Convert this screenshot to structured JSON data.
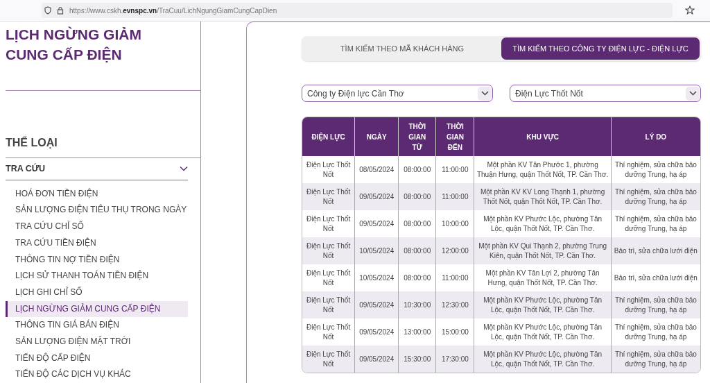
{
  "browser": {
    "url": "https://www.cskh.**evnspc.vn**/TraCuu/LichNgungGiamCungCapDien"
  },
  "page_title": "LỊCH NGỪNG GIẢM CUNG CẤP ĐIỆN",
  "sidebar": {
    "heading": "THỂ LOẠI",
    "section": {
      "label": "TRA CỨU",
      "expanded": true
    },
    "items": [
      {
        "label": "HOÁ ĐƠN TIỀN ĐIỆN",
        "selected": false
      },
      {
        "label": "SẢN LƯỢNG ĐIỆN TIÊU THỤ TRONG NGÀY",
        "selected": false
      },
      {
        "label": "TRA CỨU CHỈ SỐ",
        "selected": false
      },
      {
        "label": "TRA CỨU TIỀN ĐIỆN",
        "selected": false
      },
      {
        "label": "THÔNG TIN NỢ TIỀN ĐIỆN",
        "selected": false
      },
      {
        "label": "LỊCH SỬ THANH TOÁN TIỀN ĐIỆN",
        "selected": false
      },
      {
        "label": "LỊCH GHI CHỈ SỐ",
        "selected": false
      },
      {
        "label": "LỊCH NGỪNG GIẢM CUNG CẤP ĐIỆN",
        "selected": true
      },
      {
        "label": "THÔNG TIN GIÁ BÁN ĐIỆN",
        "selected": false
      },
      {
        "label": "SẢN LƯỢNG ĐIỆN MẶT TRỜI",
        "selected": false
      },
      {
        "label": "TIẾN ĐỘ CẤP ĐIỆN",
        "selected": false
      },
      {
        "label": "TIẾN ĐỘ CÁC DỊCH VỤ KHÁC",
        "selected": false
      }
    ]
  },
  "tabs": [
    {
      "label": "TÌM KIẾM THEO MÃ KHÁCH HÀNG",
      "selected": false
    },
    {
      "label": "TÌM KIẾM THEO CÔNG TY ĐIỆN LỰC - ĐIỆN LỰC",
      "selected": true
    }
  ],
  "filters": [
    {
      "value": "Công ty Điện lực Cần Thơ"
    },
    {
      "value": "Điện Lực Thốt Nốt"
    }
  ],
  "table": {
    "columns": [
      "ĐIỆN LỰC",
      "NGÀY",
      "THỜI GIAN TỪ",
      "THỜI GIAN ĐẾN",
      "KHU VỰC",
      "LÝ DO"
    ],
    "rows": [
      [
        "Điện Lực Thốt Nốt",
        "08/05/2024",
        "08:00:00",
        "11:00:00",
        "Một phần KV Tân Phước 1, phường Thuận Hưng, quận Thốt Nốt, TP. Cần Thơ.",
        "Thí nghiệm, sửa chữa bảo dưỡng Trung, hạ áp"
      ],
      [
        "Điện Lực Thốt Nốt",
        "09/05/2024",
        "08:00:00",
        "11:00:00",
        "Một phần KV KV Long Thạnh 1, phường Thốt Nốt, quận Thốt Nốt, TP. Cần Thơ.",
        "Thí nghiệm, sửa chữa bảo dưỡng Trung, hạ áp"
      ],
      [
        "Điện Lực Thốt Nốt",
        "09/05/2024",
        "08:00:00",
        "10:00:00",
        "Một phần KV Phước Lộc, phường Tân Lộc, quận Thốt Nốt, TP. Cần Thơ.",
        "Thí nghiệm, sửa chữa bảo dưỡng Trung, hạ áp"
      ],
      [
        "Điện Lực Thốt Nốt",
        "10/05/2024",
        "08:00:00",
        "12:00:00",
        "Một phần KV Qui Thạnh 2, phường Trung Kiên, quận Thốt Nốt, TP. Cần Thơ.",
        "Bảo trì, sửa chữa lưới điện"
      ],
      [
        "Điện Lực Thốt Nốt",
        "10/05/2024",
        "08:00:00",
        "11:00:00",
        "Một phần KV Tân Lợi 2, phường Tân Hưng, quận Thốt Nốt, TP. Cần Thơ.",
        "Bảo trì, sửa chữa lưới điện"
      ],
      [
        "Điện Lực Thốt Nốt",
        "09/05/2024",
        "10:30:00",
        "12:30:00",
        "Một phần KV Phước Lộc, phường Tân Lộc, quận Thốt Nốt, TP. Cần Thơ.",
        "Thí nghiệm, sửa chữa bảo dưỡng Trung, hạ áp"
      ],
      [
        "Điện Lực Thốt Nốt",
        "09/05/2024",
        "13:00:00",
        "15:00:00",
        "Một phần KV Phước Lộc, phường Tân Lộc, quận Thốt Nốt, TP. Cần Thơ.",
        "Thí nghiệm, sửa chữa bảo dưỡng Trung, hạ áp"
      ],
      [
        "Điện Lực Thốt Nốt",
        "09/05/2024",
        "15:30:00",
        "17:30:00",
        "Một phần KV Phước Lộc, phường Tân Lộc, quận Thốt Nốt, TP. Cần Thơ.",
        "Thí nghiệm, sửa chữa bảo dưỡng Trung, hạ áp"
      ]
    ]
  }
}
